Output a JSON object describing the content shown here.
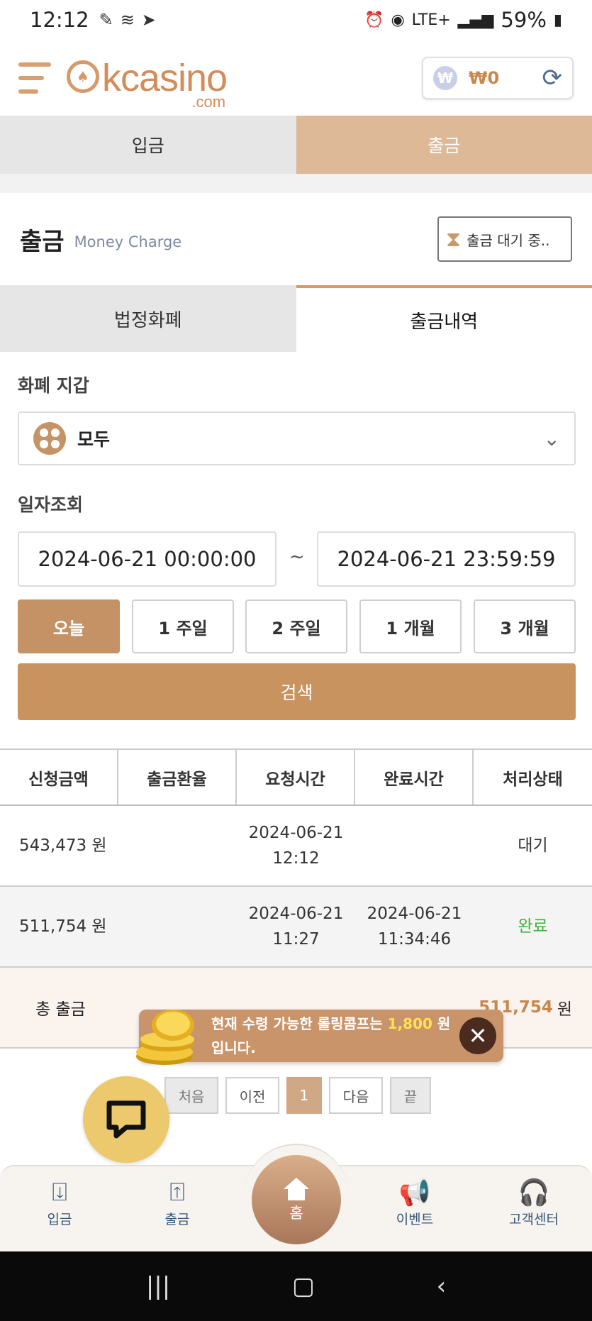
{
  "status_bar": {
    "time": "12:12",
    "network": "LTE+",
    "battery": "59%"
  },
  "header": {
    "logo_text": "kcasino",
    "logo_domain": ".com",
    "wallet_amount": "₩0",
    "won_symbol": "₩"
  },
  "main_tabs": [
    "입금",
    "출금"
  ],
  "section": {
    "title": "출금",
    "subtitle": "Money Charge",
    "pending_label": "출금 대기 중.."
  },
  "sub_tabs": [
    "법정화폐",
    "출금내역"
  ],
  "wallet_select": {
    "label": "화폐 지갑",
    "value": "모두"
  },
  "date_query": {
    "label": "일자조회",
    "start": "2024-06-21 00:00:00",
    "separator": "~",
    "end": "2024-06-21 23:59:59",
    "ranges": [
      "오늘",
      "1 주일",
      "2 주일",
      "1 개월",
      "3 개월"
    ],
    "search_label": "검색"
  },
  "table": {
    "headers": [
      "신청금액",
      "출금환율",
      "요청시간",
      "완료시간",
      "처리상태"
    ],
    "rows": [
      {
        "amount": "543,473 원",
        "rate": "",
        "req_date": "2024-06-21",
        "req_time": "12:12",
        "done_date": "",
        "done_time": "",
        "status": "대기"
      },
      {
        "amount": "511,754 원",
        "rate": "",
        "req_date": "2024-06-21",
        "req_time": "11:27",
        "done_date": "2024-06-21",
        "done_time": "11:34:46",
        "status": "완료"
      }
    ],
    "total_label": "총 출금",
    "total_value": "511,754",
    "total_unit": "원"
  },
  "pagination": {
    "first": "처음",
    "prev": "이전",
    "current": "1",
    "next": "다음",
    "last": "끝"
  },
  "toast": {
    "text_before": "현재 수령 가능한 롤링콤프는 ",
    "highlight": "1,800",
    "text_after": " 원 입니다."
  },
  "bottom_nav": {
    "deposit": "입금",
    "withdraw": "출금",
    "home": "홈",
    "event": "이벤트",
    "support": "고객센터"
  },
  "colors": {
    "accent": "#c8935f",
    "active_tab": "#ddb998",
    "done_status": "#3bb53b",
    "toast_highlight": "#ffe34a"
  }
}
